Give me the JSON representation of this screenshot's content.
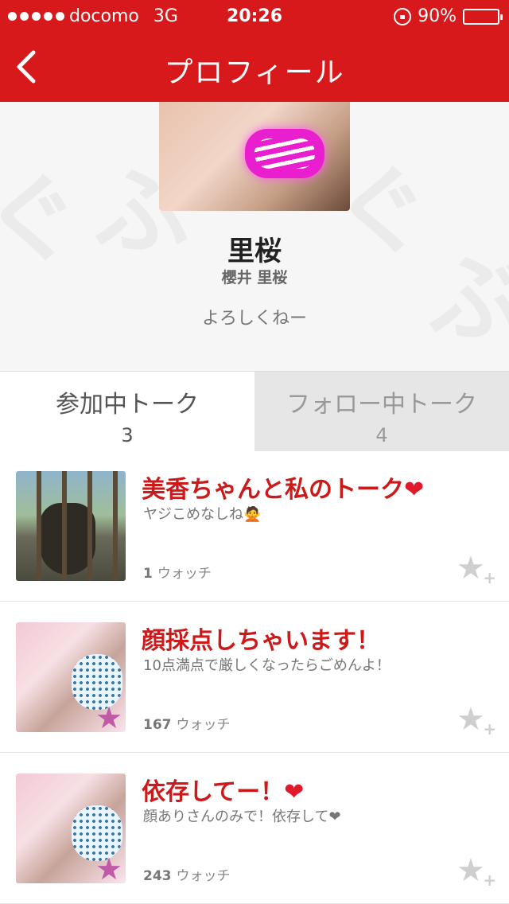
{
  "status_bar": {
    "carrier": "docomo",
    "network": "3G",
    "time": "20:26",
    "battery": "90%",
    "battery_level": 0.9,
    "signal_icon": "signal-dots-icon",
    "rotation_lock_icon": "rotation-lock-icon",
    "battery_icon": "battery-icon"
  },
  "nav": {
    "title": "プロフィール",
    "back_icon": "chevron-left-icon"
  },
  "profile": {
    "name": "里桜",
    "full_name": "櫻井 里桜",
    "message": "よろしくねー"
  },
  "tabs": [
    {
      "label": "参加中トーク",
      "count": "3",
      "active": true
    },
    {
      "label": "フォロー中トーク",
      "count": "4",
      "active": false
    }
  ],
  "talks": [
    {
      "title": "美香ちゃんと私のトーク",
      "title_emoji": "❤",
      "subtitle": "ヤジこめなしね🙅",
      "watch_count": "1",
      "watch_label": "ウォッチ"
    },
    {
      "title": "顔採点しちゃいます！",
      "title_emoji": "",
      "subtitle": "10点満点で厳しくなったらごめんよ！",
      "watch_count": "167",
      "watch_label": "ウォッチ"
    },
    {
      "title": "依存してー！",
      "title_emoji": "❤",
      "subtitle": "顔ありさんのみで！依存して❤",
      "watch_count": "243",
      "watch_label": "ウォッチ"
    }
  ],
  "colors": {
    "header": "#d7191c",
    "title_red": "#cc1a1a",
    "inactive_tab": "#e6e6e6"
  }
}
